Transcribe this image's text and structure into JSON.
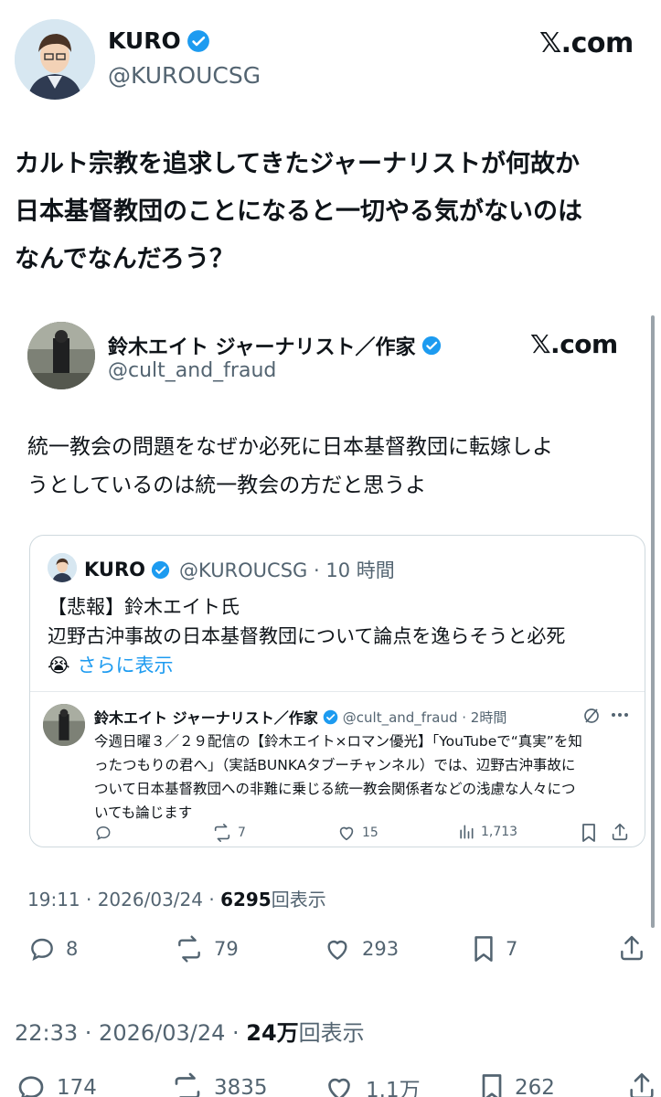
{
  "outer": {
    "name": "KURO",
    "handle": "@KUROUCSG",
    "brand": "𝕏.com",
    "text_lines": [
      "カルト宗教を追求してきたジャーナリストが何故か",
      "日本基督教団のことになると一切やる気がないのは",
      "なんでなんだろう？"
    ],
    "time": "22:33 · 2026/03/24 · ",
    "views_num": "24万",
    "views_label": "回表示",
    "actions": {
      "replies": "174",
      "reposts": "3835",
      "likes": "1.1万",
      "bookmarks": "262"
    }
  },
  "card": {
    "name": "鈴木エイト ジャーナリスト／作家",
    "handle": "@cult_and_fraud",
    "brand": "𝕏.com",
    "text_lines": [
      "統一教会の問題をなぜか必死に日本基督教団に転嫁しよ",
      "うとしているのは統一教会の方だと思うよ"
    ],
    "time": "19:11 · 2026/03/24 · ",
    "views_num": "6295",
    "views_label": "回表示",
    "actions": {
      "replies": "8",
      "reposts": "79",
      "likes": "293",
      "bookmarks": "7"
    }
  },
  "quote": {
    "name": "KURO",
    "meta": "@KUROUCSG · 10 時間",
    "line1": "【悲報】鈴木エイト氏",
    "line2": "辺野古沖事故の日本基督教団について論点を逸らそうと必死",
    "emoji": "😭",
    "more": "さらに表示"
  },
  "nested": {
    "name": "鈴木エイト ジャーナリスト／作家",
    "meta": "@cult_and_fraud · 2時間",
    "text_lines": [
      "今週日曜３／２９配信の【鈴木エイト×ロマン優光】「YouTubeで“真実”を知",
      "ったつもりの君へ」（実話BUNKAタブーチャンネル）では、辺野古沖事故に",
      "ついて日本基督教団への非難に乗じる統一教会関係者などの浅慮な人々につ",
      "いても論じます"
    ],
    "actions": {
      "reposts": "7",
      "likes": "15",
      "views": "1,713"
    }
  },
  "colors": {
    "verified": "#1d9bf0",
    "link": "#1d9bf0",
    "muted": "#536471",
    "border": "#cfd9de"
  }
}
